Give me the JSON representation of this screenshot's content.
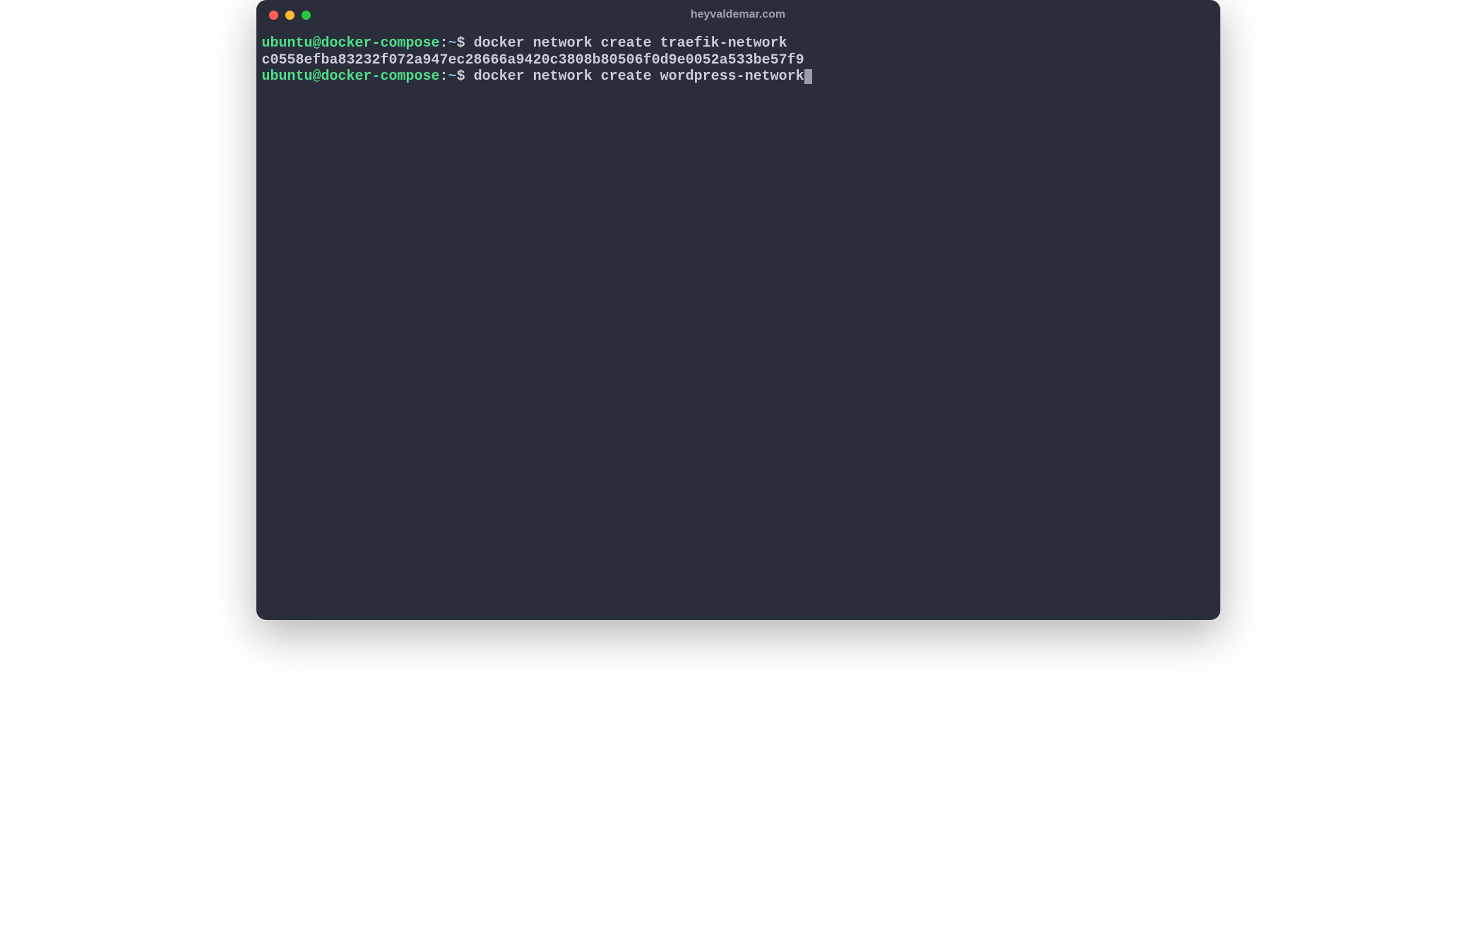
{
  "window": {
    "title": "heyvaldemar.com"
  },
  "prompt": {
    "user_host": "ubuntu@docker-compose",
    "colon": ":",
    "path": "~",
    "symbol": "$"
  },
  "lines": [
    {
      "type": "prompt",
      "command": "docker network create traefik-network"
    },
    {
      "type": "output",
      "text": "c0558efba83232f072a947ec28666a9420c3808b80506f0d9e0052a533be57f9"
    },
    {
      "type": "prompt",
      "command": "docker network create wordpress-network",
      "cursor": true
    }
  ]
}
